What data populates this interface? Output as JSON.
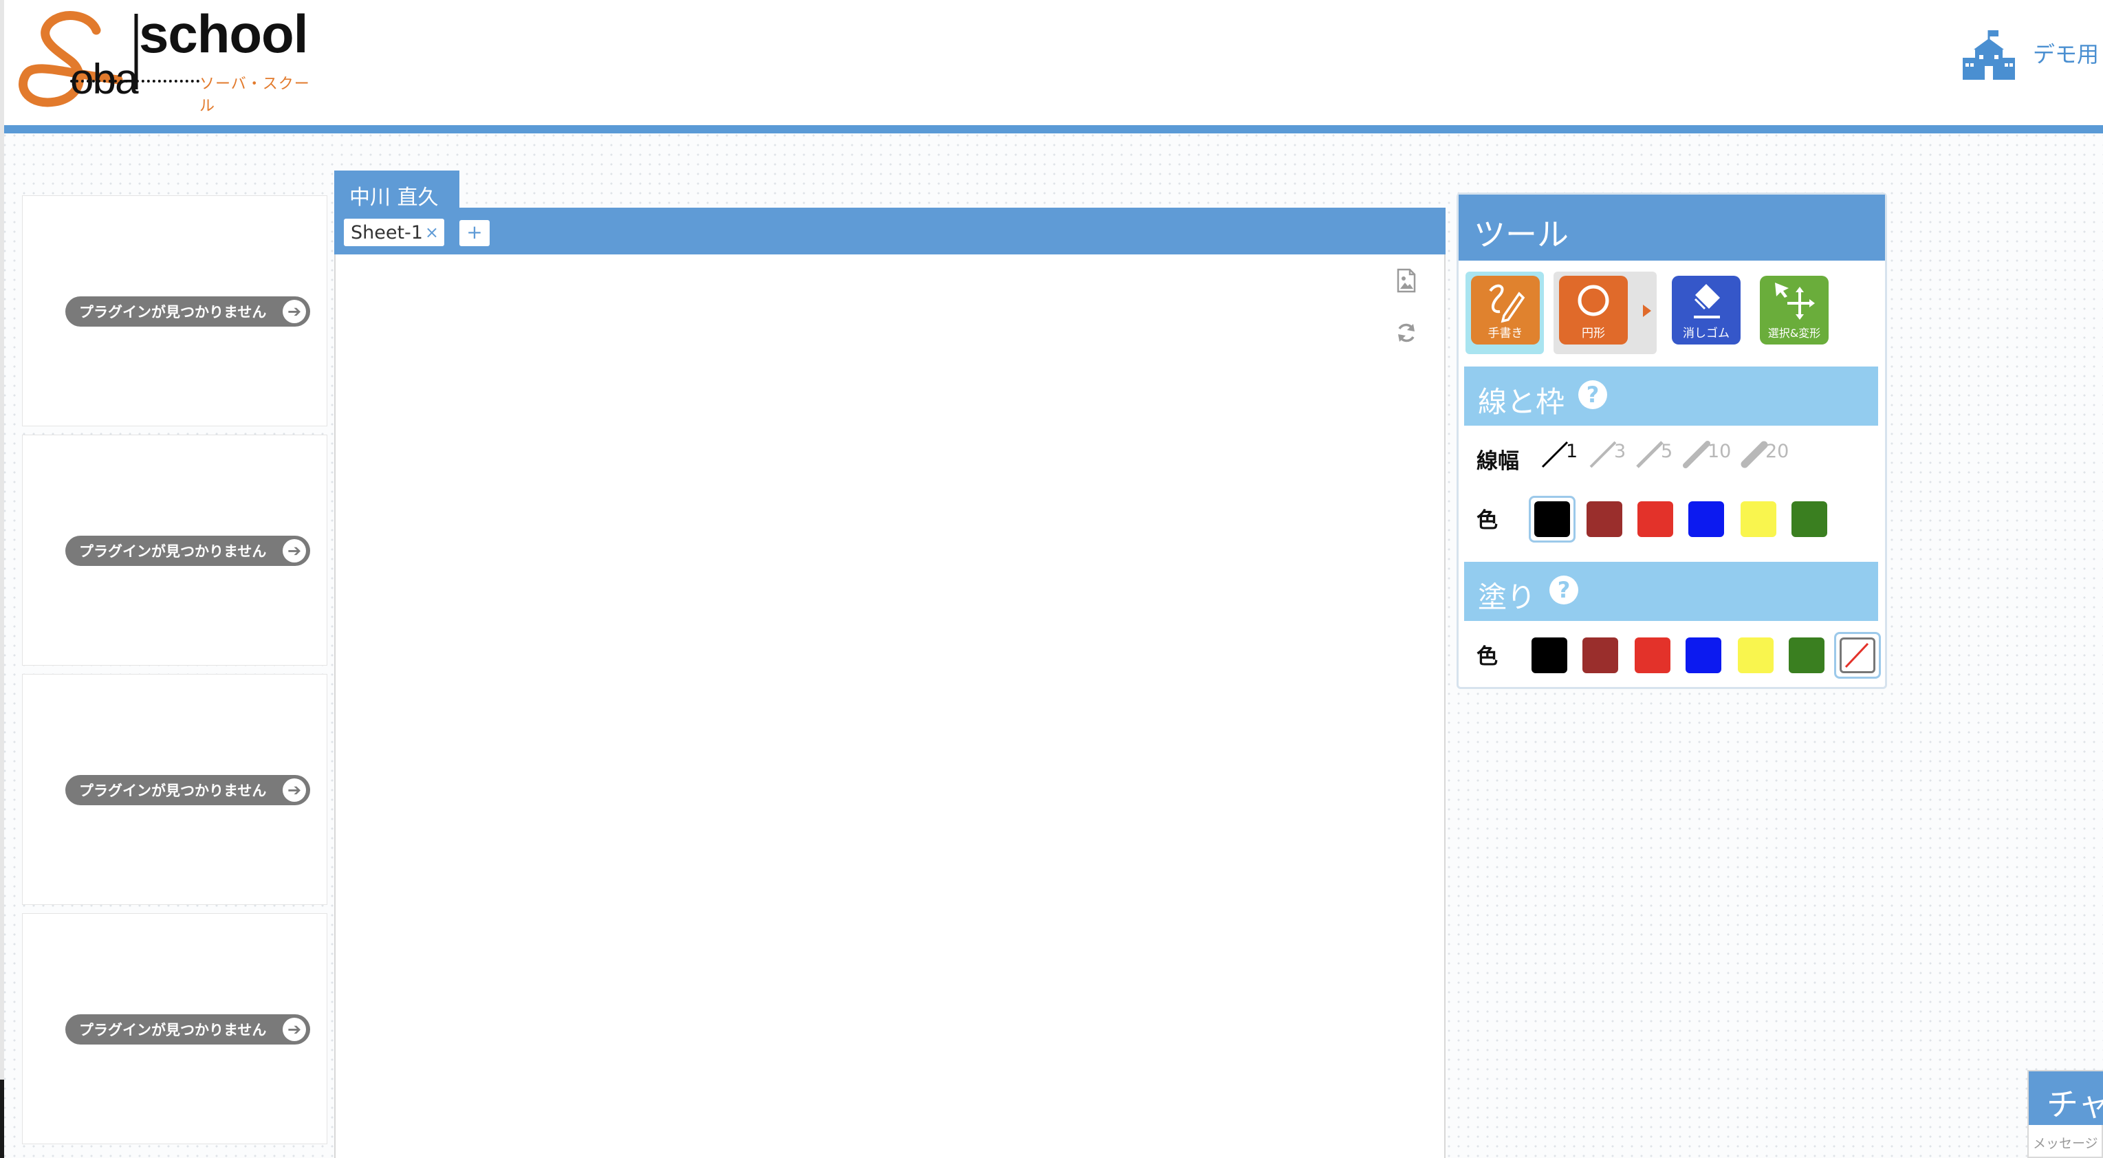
{
  "header": {
    "logo_text": "school",
    "logo_subtitle": "ソーバ・スクール",
    "user_label": "デモ用"
  },
  "plugins": [
    {
      "label": "プラグインが見つかりません"
    },
    {
      "label": "プラグインが見つかりません"
    },
    {
      "label": "プラグインが見つかりません"
    },
    {
      "label": "プラグインが見つかりません"
    }
  ],
  "whiteboard": {
    "user_tab": "中川 直久",
    "sheets": [
      {
        "label": "Sheet-1",
        "close": "×"
      }
    ],
    "add_sheet": "+",
    "icons": [
      "image-export-icon",
      "refresh-icon"
    ]
  },
  "tools": {
    "title": "ツール",
    "buttons": [
      {
        "label": "手書き",
        "icon": "pen-icon",
        "color": "#e0822e",
        "active": true
      },
      {
        "label": "円形",
        "icon": "circle-icon",
        "color": "#e06a2a",
        "active": false
      },
      {
        "label": "消しゴム",
        "icon": "eraser-icon",
        "color": "#3557c9",
        "active": false
      },
      {
        "label": "選択&変形",
        "icon": "move-icon",
        "color": "#6aad3b",
        "active": false
      }
    ],
    "line_section": {
      "title": "線と枠",
      "help": "?",
      "width_label": "線幅",
      "widths": [
        "1",
        "3",
        "5",
        "10",
        "20"
      ],
      "selected_width": "1",
      "color_label": "色",
      "colors": [
        "#000000",
        "#9a2e2c",
        "#e3322a",
        "#0c1af0",
        "#f9f54e",
        "#3a7f20"
      ],
      "selected_color": "#000000"
    },
    "fill_section": {
      "title": "塗り",
      "help": "?",
      "color_label": "色",
      "colors": [
        "#000000",
        "#9a2e2c",
        "#e3322a",
        "#0c1af0",
        "#f9f54e",
        "#3a7f20",
        "none"
      ],
      "selected_color": "none"
    }
  },
  "chat": {
    "title": "チャ",
    "placeholder": "メッセージ"
  }
}
